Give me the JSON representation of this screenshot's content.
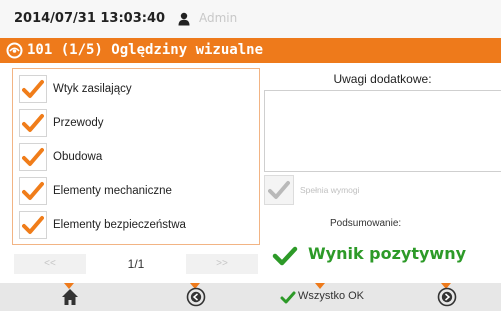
{
  "status": {
    "datetime": "2014/07/31 13:03:40",
    "user": "Admin"
  },
  "title": {
    "text": "101 (1/5) Oględziny wizualne"
  },
  "checklist": {
    "items": [
      {
        "label": "Wtyk zasilający",
        "checked": true
      },
      {
        "label": "Przewody",
        "checked": true
      },
      {
        "label": "Obudowa",
        "checked": true
      },
      {
        "label": "Elementy mechaniczne",
        "checked": true
      },
      {
        "label": "Elementy bezpieczeństwa",
        "checked": true
      }
    ]
  },
  "pager": {
    "prev": "<<",
    "page": "1/1",
    "next": ">>"
  },
  "remarks": {
    "label": "Uwagi dodatkowe:",
    "value": ""
  },
  "requirements": {
    "label": "Spełnia wymogi",
    "checked": true,
    "enabled": false
  },
  "summary": {
    "label": "Podsumowanie:",
    "result": "Wynik pozytywny"
  },
  "bottom_bar": {
    "all_ok_label": "Wszystko OK"
  },
  "colors": {
    "accent": "#ee7a1b",
    "success": "#2d9a28",
    "check": "#f07d1a"
  }
}
